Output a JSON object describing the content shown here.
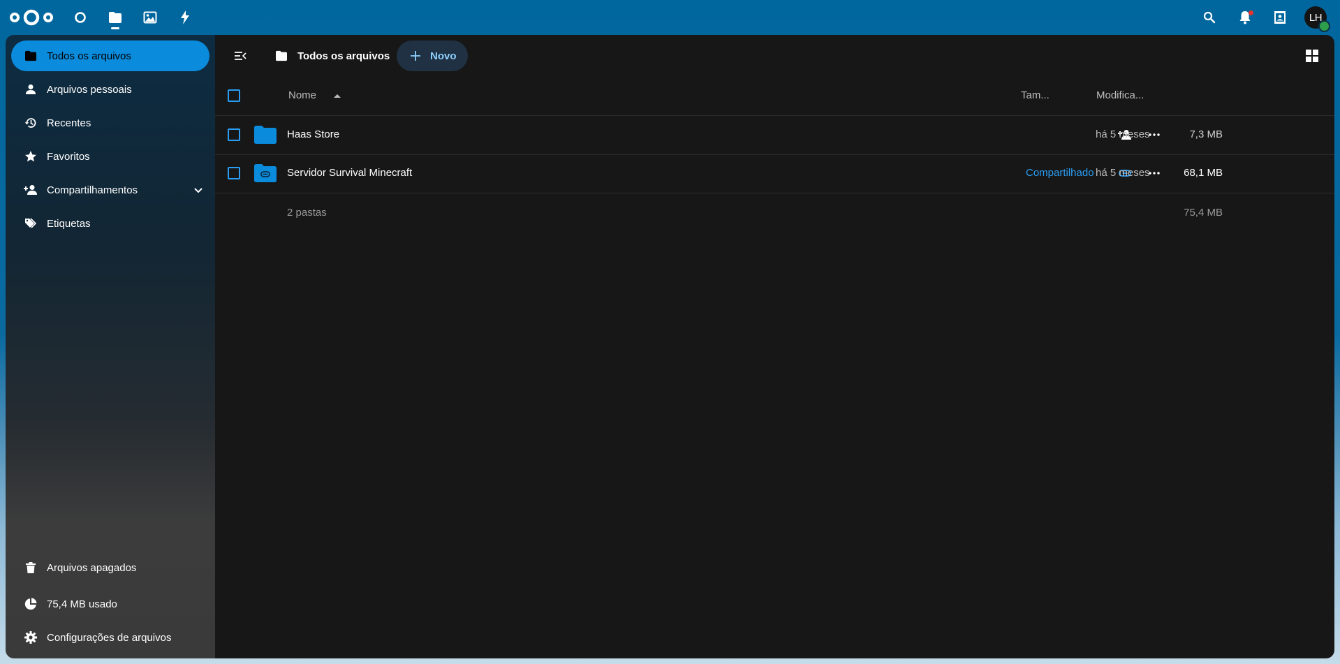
{
  "header": {
    "apps": [
      {
        "name": "dashboard",
        "icon": "circle-icon"
      },
      {
        "name": "files",
        "icon": "folder-icon",
        "active": true
      },
      {
        "name": "photos",
        "icon": "image-icon"
      },
      {
        "name": "activity",
        "icon": "lightning-icon"
      }
    ],
    "right_icons": [
      "search-icon",
      "bell-icon",
      "contacts-icon"
    ],
    "avatar_initials": "LH"
  },
  "sidebar": {
    "items": [
      {
        "label": "Todos os arquivos",
        "icon": "folder-icon",
        "active": true
      },
      {
        "label": "Arquivos pessoais",
        "icon": "person-icon"
      },
      {
        "label": "Recentes",
        "icon": "history-icon"
      },
      {
        "label": "Favoritos",
        "icon": "star-icon"
      },
      {
        "label": "Compartilhamentos",
        "icon": "share-person-icon",
        "expandable": true
      },
      {
        "label": "Etiquetas",
        "icon": "tag-icon"
      }
    ],
    "bottom": {
      "trash_label": "Arquivos apagados",
      "quota_label": "75,4 MB usado",
      "settings_label": "Configurações de arquivos"
    }
  },
  "main": {
    "breadcrumb": "Todos os arquivos",
    "new_button": "Novo",
    "columns": {
      "name": "Nome",
      "size": "Tam...",
      "modified": "Modifica..."
    },
    "rows": [
      {
        "name": "Haas Store",
        "size": "7,3 MB",
        "modified": "há 5 meses",
        "shared": false
      },
      {
        "name": "Servidor Survival Minecraft",
        "size": "68,1 MB",
        "modified": "há 5 meses",
        "shared": true,
        "shared_label": "Compartilhado"
      }
    ],
    "summary": {
      "count": "2 pastas",
      "total": "75,4 MB"
    }
  },
  "colors": {
    "accent": "#0a8bdc",
    "link": "#2a9df4",
    "header_bg": "#00679e",
    "content_bg": "#171717"
  }
}
